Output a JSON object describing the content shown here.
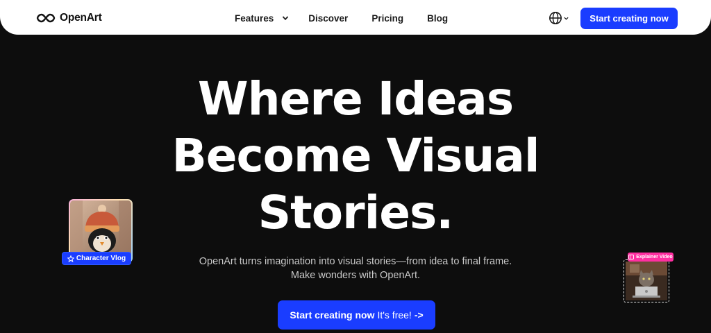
{
  "header": {
    "logo_text": "OpenArt",
    "nav": [
      {
        "label": "Features",
        "has_dropdown": true
      },
      {
        "label": "Discover"
      },
      {
        "label": "Pricing"
      },
      {
        "label": "Blog"
      }
    ],
    "language_icon": "globe-icon",
    "cta_label": "Start creating now"
  },
  "hero": {
    "title_lines": [
      "Where Ideas",
      "Become Visual",
      "Stories."
    ],
    "subtitle_lines": [
      "OpenArt turns imagination into visual stories—from idea to final frame.",
      "Make wonders with OpenArt."
    ],
    "cta_strong": "Start creating now",
    "cta_light": "It's free!",
    "cta_arrow": "->"
  },
  "floating_cards": {
    "left_tag": "Character Vlog",
    "right_tag": "Explainer Video"
  },
  "colors": {
    "accent_blue": "#1a3dff",
    "tag_pink": "#ff2fa1",
    "background": "#0d0d0d"
  }
}
